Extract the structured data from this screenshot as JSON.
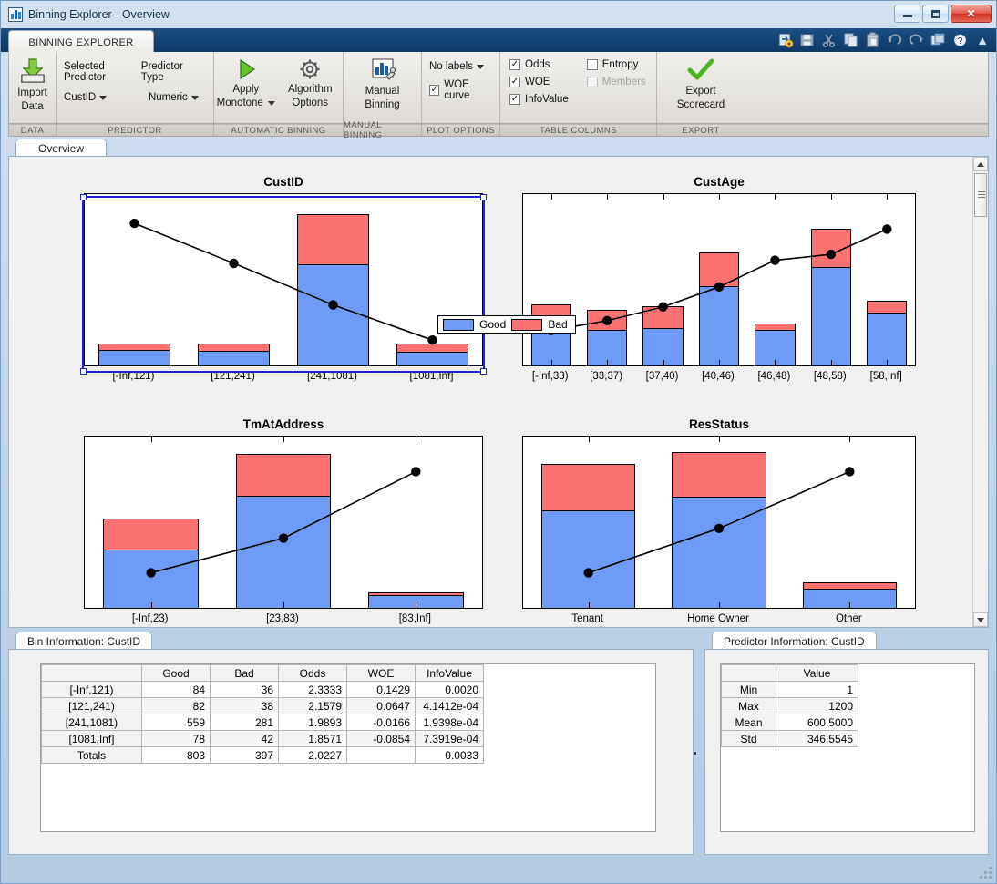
{
  "window": {
    "title": "Binning Explorer - Overview",
    "icon": "app-chart-icon",
    "minimize_label": "Minimize",
    "maximize_label": "Maximize",
    "close_label": "✕"
  },
  "ribbon": {
    "tab_label": "BINNING EXPLORER",
    "quick_access": [
      "new-document-icon",
      "save-icon",
      "cut-icon",
      "copy-icon",
      "paste-icon",
      "undo-icon",
      "redo-icon",
      "layout-icon",
      "help-icon"
    ],
    "collapse_label": "▲",
    "sections": [
      {
        "name": "DATA",
        "label": "DATA"
      },
      {
        "name": "PREDICTOR",
        "label": "PREDICTOR"
      },
      {
        "name": "AUTOMATIC BINNING",
        "label": "AUTOMATIC BINNING"
      },
      {
        "name": "MANUAL BINNING",
        "label": "MANUAL BINNING"
      },
      {
        "name": "PLOT OPTIONS",
        "label": "PLOT OPTIONS"
      },
      {
        "name": "TABLE COLUMNS",
        "label": "TABLE COLUMNS"
      },
      {
        "name": "EXPORT",
        "label": "EXPORT"
      }
    ],
    "import_data": {
      "line1": "Import",
      "line2": "Data"
    },
    "predictor": {
      "selected_predictor_label": "Selected Predictor",
      "selected_predictor_value": "CustID",
      "predictor_type_label": "Predictor Type",
      "predictor_type_value": "Numeric"
    },
    "automatic_binning": {
      "apply_monotone_line1": "Apply",
      "apply_monotone_line2": "Monotone",
      "algorithm_options_line1": "Algorithm",
      "algorithm_options_line2": "Options"
    },
    "manual_binning": {
      "line1": "Manual",
      "line2": "Binning"
    },
    "plot_options": {
      "labels_value": "No labels",
      "woe_curve_label": "WOE curve",
      "woe_curve_checked": true
    },
    "table_columns": [
      {
        "label": "Odds",
        "checked": true,
        "enabled": true
      },
      {
        "label": "WOE",
        "checked": true,
        "enabled": true
      },
      {
        "label": "InfoValue",
        "checked": true,
        "enabled": true
      },
      {
        "label": "Entropy",
        "checked": false,
        "enabled": true
      },
      {
        "label": "Members",
        "checked": false,
        "enabled": false
      }
    ],
    "export": {
      "line1": "Export",
      "line2": "Scorecard"
    }
  },
  "overview": {
    "tab_label": "Overview",
    "legend": [
      {
        "label": "Good",
        "color": "#6e9bf5"
      },
      {
        "label": "Bad",
        "color": "#fc7272"
      }
    ]
  },
  "chart_data": [
    {
      "type": "bar",
      "title": "CustID",
      "selected": true,
      "categories": [
        "[-Inf,121)",
        "[121,241)",
        "[241,1081)",
        "[1081,Inf]"
      ],
      "series": [
        {
          "name": "Good",
          "color": "#6e9bf5",
          "values": [
            84,
            82,
            559,
            78
          ]
        },
        {
          "name": "Bad",
          "color": "#fc7272",
          "values": [
            36,
            38,
            281,
            42
          ]
        }
      ],
      "woe_curve": {
        "name": "WOE",
        "values": [
          0.1429,
          0.0647,
          -0.0166,
          -0.0854
        ]
      },
      "ylim": [
        0,
        950
      ],
      "woe_ylim": [
        -0.11,
        0.175
      ],
      "grid": false,
      "legend_position": "top-center"
    },
    {
      "type": "bar",
      "title": "CustAge",
      "selected": false,
      "categories": [
        "[-Inf,33)",
        "[33,37)",
        "[37,40)",
        "[40,46)",
        "[46,48)",
        "[48,58)",
        "[58,Inf]"
      ],
      "series": [
        {
          "name": "Good",
          "color": "#6e9bf5",
          "values": [
            53,
            58,
            61,
            129,
            58,
            161,
            87
          ]
        },
        {
          "name": "Bad",
          "color": "#fc7272",
          "values": [
            47,
            33,
            36,
            55,
            10,
            62,
            19
          ]
        }
      ],
      "woe_curve": {
        "name": "WOE",
        "values": [
          -0.846,
          -0.69,
          -0.469,
          -0.149,
          0.279,
          0.374,
          0.778
        ]
      },
      "ylim": [
        0,
        280
      ],
      "grid": false
    },
    {
      "type": "bar",
      "title": "TmAtAddress",
      "selected": false,
      "categories": [
        "[-Inf,23)",
        "[23,83)",
        "[83,Inf]"
      ],
      "series": [
        {
          "name": "Good",
          "color": "#6e9bf5",
          "values": [
            258,
            496,
            55
          ]
        },
        {
          "name": "Bad",
          "color": "#fc7272",
          "values": [
            140,
            186,
            12
          ]
        }
      ],
      "woe_curve": {
        "name": "WOE",
        "values": [
          -0.201,
          0.038,
          0.498
        ]
      },
      "ylim": [
        0,
        760
      ],
      "grid": false
    },
    {
      "type": "bar",
      "title": "ResStatus",
      "selected": false,
      "categories": [
        "Tenant",
        "Home Owner",
        "Other"
      ],
      "series": [
        {
          "name": "Good",
          "color": "#6e9bf5",
          "values": [
            376,
            430,
            75
          ]
        },
        {
          "name": "Bad",
          "color": "#fc7272",
          "values": [
            178,
            169,
            22
          ]
        }
      ],
      "woe_curve": {
        "name": "WOE",
        "values": [
          -0.157,
          0.069,
          0.358
        ]
      },
      "ylim": [
        0,
        660
      ],
      "grid": false
    }
  ],
  "bin_information": {
    "tab_label": "Bin Information: CustID",
    "columns": [
      "",
      "Good",
      "Bad",
      "Odds",
      "WOE",
      "InfoValue"
    ],
    "rows": [
      {
        "bin": "[-Inf,121)",
        "good": "84",
        "bad": "36",
        "odds": "2.3333",
        "woe": "0.1429",
        "infovalue": "0.0020"
      },
      {
        "bin": "[121,241)",
        "good": "82",
        "bad": "38",
        "odds": "2.1579",
        "woe": "0.0647",
        "infovalue": "4.1412e-04"
      },
      {
        "bin": "[241,1081)",
        "good": "559",
        "bad": "281",
        "odds": "1.9893",
        "woe": "-0.0166",
        "infovalue": "1.9398e-04"
      },
      {
        "bin": "[1081,Inf]",
        "good": "78",
        "bad": "42",
        "odds": "1.8571",
        "woe": "-0.0854",
        "infovalue": "7.3919e-04"
      },
      {
        "bin": "Totals",
        "good": "803",
        "bad": "397",
        "odds": "2.0227",
        "woe": "",
        "infovalue": "0.0033"
      }
    ]
  },
  "predictor_information": {
    "tab_label": "Predictor Information: CustID",
    "columns": [
      "",
      "Value"
    ],
    "rows": [
      {
        "stat": "Min",
        "value": "1"
      },
      {
        "stat": "Max",
        "value": "1200"
      },
      {
        "stat": "Mean",
        "value": "600.5000"
      },
      {
        "stat": "Std",
        "value": "346.5545"
      }
    ]
  }
}
